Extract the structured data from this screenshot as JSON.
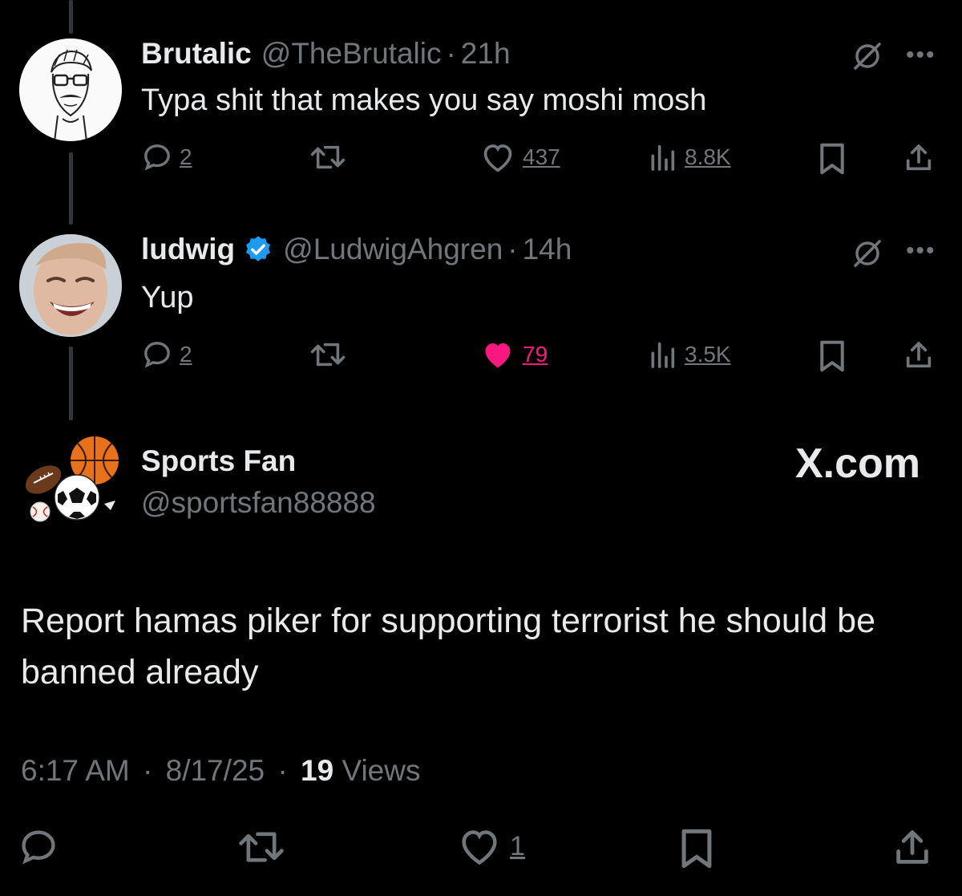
{
  "tweets": [
    {
      "name": "Brutalic",
      "handle": "@TheBrutalic",
      "time": "21h",
      "text": "Typa shit that makes you say moshi mosh",
      "replies": "2",
      "likes": "437",
      "views": "8.8K",
      "liked": false
    },
    {
      "name": "ludwig",
      "handle": "@LudwigAhgren",
      "time": "14h",
      "text": "Yup",
      "replies": "2",
      "likes": "79",
      "views": "3.5K",
      "liked": true,
      "verified": true
    }
  ],
  "main_tweet": {
    "name": "Sports Fan",
    "handle": "@sportsfan88888",
    "brand": "X.com",
    "text": "Report hamas piker for supporting terrorist he should be banned already",
    "time": "6:17 AM",
    "date": "8/17/25",
    "views_count": "19",
    "views_label": "Views",
    "likes": "1"
  },
  "separator": "·",
  "colors": {
    "background": "#000000",
    "text": "#e7e9ea",
    "secondary": "#71767b",
    "like": "#f91880",
    "verified": "#1d9bf0"
  }
}
